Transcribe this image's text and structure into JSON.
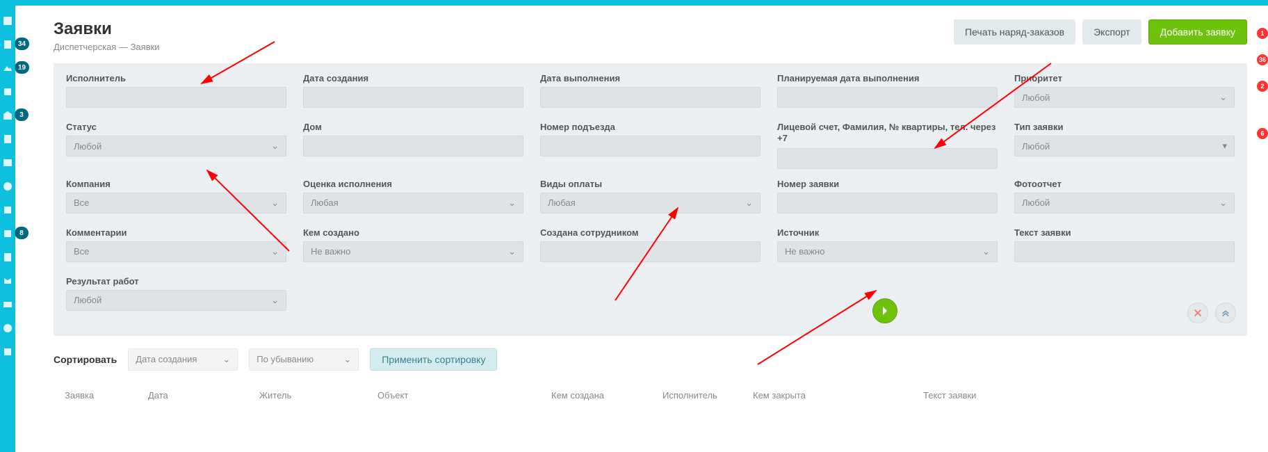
{
  "header": {
    "title": "Заявки",
    "breadcrumb_link": "Диспетчерская",
    "breadcrumb_sep": " — ",
    "breadcrumb_current": "Заявки"
  },
  "buttons": {
    "print": "Печать наряд-заказов",
    "export": "Экспорт",
    "add": "Добавить заявку"
  },
  "filters": {
    "executor": {
      "label": "Исполнитель",
      "value": ""
    },
    "created_date": {
      "label": "Дата создания",
      "value": ""
    },
    "done_date": {
      "label": "Дата выполнения",
      "value": ""
    },
    "planned_date": {
      "label": "Планируемая дата выполнения",
      "value": ""
    },
    "priority": {
      "label": "Приоритет",
      "value": "Любой"
    },
    "status": {
      "label": "Статус",
      "value": "Любой"
    },
    "house": {
      "label": "Дом",
      "value": ""
    },
    "entrance": {
      "label": "Номер подъезда",
      "value": ""
    },
    "account": {
      "label": "Лицевой счет, Фамилия, № квартиры, тел. через +7",
      "value": ""
    },
    "type": {
      "label": "Тип заявки",
      "value": "Любой"
    },
    "company": {
      "label": "Компания",
      "value": "Все"
    },
    "grade": {
      "label": "Оценка исполнения",
      "value": "Любая"
    },
    "payment": {
      "label": "Виды оплаты",
      "value": "Любая"
    },
    "number": {
      "label": "Номер заявки",
      "value": ""
    },
    "photo": {
      "label": "Фотоотчет",
      "value": "Любой"
    },
    "comments": {
      "label": "Комментарии",
      "value": "Все"
    },
    "created_by_kind": {
      "label": "Кем создано",
      "value": "Не важно"
    },
    "created_by_staff": {
      "label": "Создана сотрудником",
      "value": ""
    },
    "source": {
      "label": "Источник",
      "value": "Не важно"
    },
    "text": {
      "label": "Текст заявки",
      "value": ""
    },
    "result": {
      "label": "Результат работ",
      "value": "Любой"
    }
  },
  "sort": {
    "label": "Сортировать",
    "field": "Дата создания",
    "direction": "По убыванию",
    "apply": "Применить сортировку"
  },
  "table": {
    "col_request": "Заявка",
    "col_date": "Дата",
    "col_resident": "Житель",
    "col_object": "Объект",
    "col_created_by": "Кем создана",
    "col_executor": "Исполнитель",
    "col_closed_by": "Кем закрыта",
    "col_text": "Текст заявки"
  },
  "sidebar_badges": [
    "34",
    "19",
    "3",
    "8"
  ],
  "right_badges": [
    "1",
    "36",
    "2",
    "6"
  ]
}
